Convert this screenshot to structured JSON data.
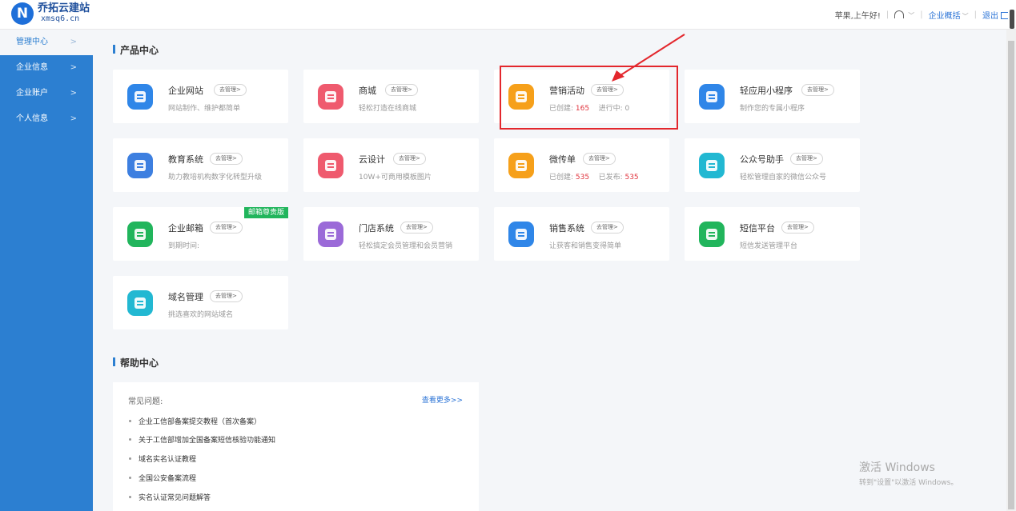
{
  "header": {
    "logo_title": "乔拓云建站",
    "logo_sub": "xmsq6.cn",
    "greeting": "苹果,上午好!",
    "enterprise_overview": "企业概括",
    "logout": "退出"
  },
  "sidebar": {
    "items": [
      {
        "label": "管理中心"
      },
      {
        "label": "企业信息"
      },
      {
        "label": "企业账户"
      },
      {
        "label": "个人信息"
      }
    ]
  },
  "product_center": {
    "title": "产品中心",
    "manage_label": "去管理>",
    "cards": [
      {
        "name": "企业网站",
        "desc": "网站制作、维护都简单",
        "color": "#2f86e8"
      },
      {
        "name": "商城",
        "desc": "轻松打造在线商城",
        "color": "#ef5a6e"
      },
      {
        "name": "营销活动",
        "desc_prefix1": "已创建:",
        "value1": "165",
        "desc_prefix2": "进行中:",
        "value2": "0",
        "color": "#f6a01a"
      },
      {
        "name": "轻应用小程序",
        "desc": "制作您的专属小程序",
        "color": "#2f86e8"
      },
      {
        "name": "教育系统",
        "desc": "助力教培机构数字化转型升级",
        "color": "#3d7fe0"
      },
      {
        "name": "云设计",
        "desc": "10W+可商用模板图片",
        "color": "#ef5a6e"
      },
      {
        "name": "微传单",
        "desc_prefix1": "已创建:",
        "value1": "535",
        "desc_prefix2": "已发布:",
        "value2": "535",
        "color": "#f6a01a"
      },
      {
        "name": "公众号助手",
        "desc": "轻松管理自家的微信公众号",
        "color": "#22b8d2"
      },
      {
        "name": "企业邮箱",
        "desc": "到期时间:",
        "ribbon": "邮箱尊贵版",
        "color": "#21b55c"
      },
      {
        "name": "门店系统",
        "desc": "轻松搞定会员管理和会员营销",
        "color": "#9b6ad8"
      },
      {
        "name": "销售系统",
        "desc": "让获客和销售变得简单",
        "color": "#2f86e8"
      },
      {
        "name": "短信平台",
        "desc": "短信发送管理平台",
        "color": "#21b55c"
      },
      {
        "name": "域名管理",
        "desc": "挑选喜欢的网站域名",
        "color": "#22b8d2"
      }
    ]
  },
  "help_center": {
    "title": "帮助中心",
    "faq_label": "常见问题:",
    "more_link": "查看更多>>",
    "items": [
      "企业工信部备案提交教程（首次备案）",
      "关于工信部增加全国备案短信核验功能通知",
      "域名实名认证教程",
      "全国公安备案流程",
      "实名认证常见问题解答"
    ]
  },
  "watermark": {
    "line1": "激活 Windows",
    "line2": "转到\"设置\"以激活 Windows。"
  },
  "colors": {
    "sidebar": "#2c7fd1",
    "highlight": "#e3272d",
    "accent_red": "#e0333d",
    "link": "#2a73d6"
  }
}
